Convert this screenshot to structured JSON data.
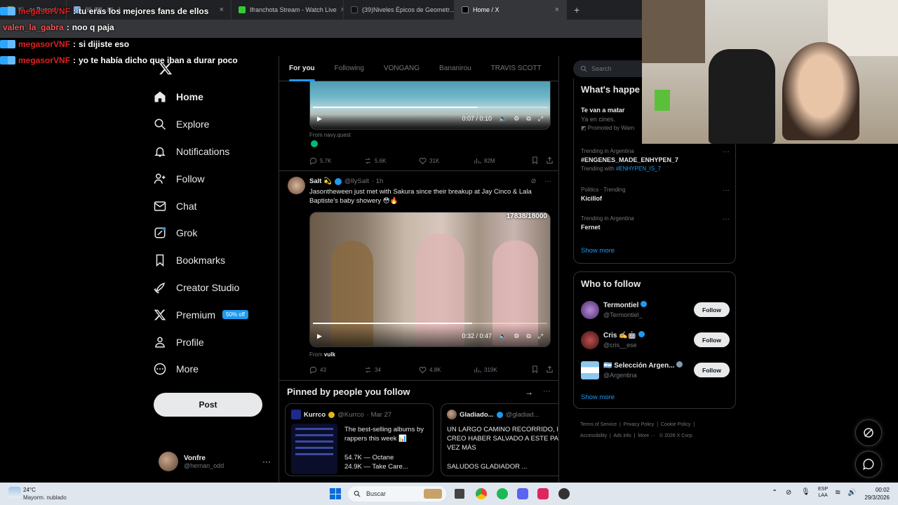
{
  "browser": {
    "tabs": [
      {
        "label": "Ki...ar Bueno!",
        "active": false
      },
      {
        "label": "(ii) (fifi...Hi...) ...",
        "active": false
      },
      {
        "label": "Ifranchota Stream - Watch Live",
        "active": false
      },
      {
        "label": "(39)Niveles Épicos de Geometr...",
        "active": false
      },
      {
        "label": "Home / X",
        "active": true
      }
    ],
    "new_tab": "+"
  },
  "chat": [
    {
      "user": "megasorVNF",
      "message": "tu eras los mejores fans de ellos",
      "color": "#d22"
    },
    {
      "user": "valen_la_gabra",
      "message": "noo q paja",
      "color": "#e55"
    },
    {
      "user": "megasorVNF",
      "message": "si dijiste eso",
      "color": "#d22"
    },
    {
      "user": "megasorVNF",
      "message": "yo te había dicho que iban a durar poco",
      "color": "#d22"
    }
  ],
  "sidebar": {
    "items": [
      {
        "label": "Home",
        "icon": "home-icon"
      },
      {
        "label": "Explore",
        "icon": "search-icon"
      },
      {
        "label": "Notifications",
        "icon": "bell-icon"
      },
      {
        "label": "Follow",
        "icon": "person-add-icon"
      },
      {
        "label": "Chat",
        "icon": "mail-icon"
      },
      {
        "label": "Grok",
        "icon": "grok-icon"
      },
      {
        "label": "Bookmarks",
        "icon": "bookmark-icon"
      },
      {
        "label": "Creator Studio",
        "icon": "rocket-icon"
      },
      {
        "label": "Premium",
        "icon": "x-logo-icon",
        "badge": "50% off"
      },
      {
        "label": "Profile",
        "icon": "person-icon"
      },
      {
        "label": "More",
        "icon": "more-circle-icon"
      }
    ],
    "post_label": "Post",
    "account": {
      "name": "Vonfre",
      "handle": "@hernan_odd"
    }
  },
  "feed": {
    "tabs": [
      "For you",
      "Following",
      "VONGANG",
      "Bananirou",
      "TRAVIS SCOTT"
    ],
    "post1": {
      "video_time": "0:07 / 0:10",
      "progress": 0.7,
      "from_label": "From navy.quest",
      "stats": {
        "replies": "5.7K",
        "reposts": "5.6K",
        "likes": "31K",
        "views": "82M"
      }
    },
    "post2": {
      "name": "Salt 💫",
      "handle": "@llySalt",
      "time": "· 1h",
      "text": "Jasontheween just met with Sakura since their breakup at Jay Cinco & Lala Baptiste's baby showery 😳🔥",
      "counter": "17838/18000",
      "video_time": "0:32 / 0:47",
      "progress": 0.68,
      "from_prefix": "From",
      "from_user": "vulk",
      "stats": {
        "replies": "43",
        "reposts": "34",
        "likes": "4.8K",
        "views": "319K"
      }
    },
    "pinned": {
      "title": "Pinned by people you follow",
      "cards": [
        {
          "name": "Kurrco",
          "handle": "@Kurrco",
          "date": "· Mar 27",
          "text": "The best-selling albums by rappers this week 📊",
          "line1": "54.7K — Octane",
          "line2": "24.9K — Take Care..."
        },
        {
          "name": "Gladiado...",
          "handle": "@gladiad...",
          "text": "UN LARGO CAMINO RECORRIDO, I CREO HABER SALVADO A ESTE PA VEZ MÁS",
          "text2": "SALUDOS GLADIADOR ..."
        }
      ]
    }
  },
  "right": {
    "search_placeholder": "Search",
    "whats_happening": "What's happe",
    "promo": {
      "title": "Te van a matar",
      "sub": "Ya en cines.",
      "promoted": "Promoted by Warn"
    },
    "trends": [
      {
        "context": "Trending in Argentina",
        "name": "#ENGENES_MADE_ENHYPEN_7",
        "extra_prefix": "Trending with",
        "extra": "#ENHYPEN_IS_7"
      },
      {
        "context": "Politics · Trending",
        "name": "Kicillof"
      },
      {
        "context": "Trending in Argentina",
        "name": "Fernet"
      }
    ],
    "show_more": "Show more",
    "who_to_follow": "Who to follow",
    "follow_label": "Follow",
    "suggestions": [
      {
        "name": "Termontiel",
        "handle": "@Termontiel_"
      },
      {
        "name": "Cris ✍️🤖",
        "handle": "@cris__ese"
      },
      {
        "name": "🇦🇷 Selección Argen...",
        "handle": "@Argentina"
      }
    ],
    "footer": [
      "Terms of Service",
      "Privacy Policy",
      "Cookie Policy",
      "Accessibility",
      "Ads info",
      "More ···",
      "© 2026 X Corp."
    ]
  },
  "taskbar": {
    "weather_temp": "24°C",
    "weather_desc": "Mayorm. nublado",
    "search_placeholder": "Buscar",
    "lang": "ESP",
    "lang2": "LAA",
    "time": "00:02",
    "date": "29/3/2026"
  },
  "colors": {
    "accent": "#1d9bf0",
    "background": "#000000",
    "border": "#2f3336",
    "muted": "#71767b"
  }
}
